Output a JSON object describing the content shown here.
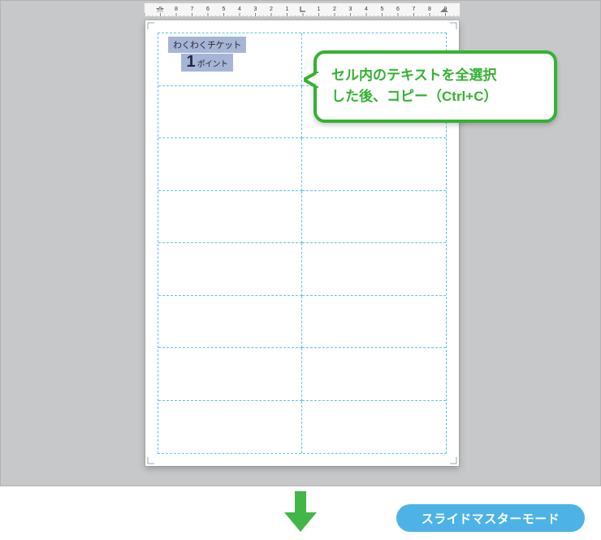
{
  "ruler": {
    "min": 1,
    "max": 20,
    "origin_index": 10
  },
  "ticket": {
    "line1": "わくわくチケット",
    "number": "1",
    "unit": "ポイント"
  },
  "callout": {
    "line1": "セル内のテキストを全選択",
    "line2": "した後、コピー（Ctrl+C）"
  },
  "mode_pill": "スライドマスターモード",
  "colors": {
    "accent_green": "#34b233",
    "pill_blue": "#4db3e6",
    "grid_blue": "#5cc5e8",
    "selection_bg": "#a6b5d7",
    "canvas_bg": "#bfc1c2"
  },
  "grid": {
    "rows": 8,
    "cols": 2
  }
}
